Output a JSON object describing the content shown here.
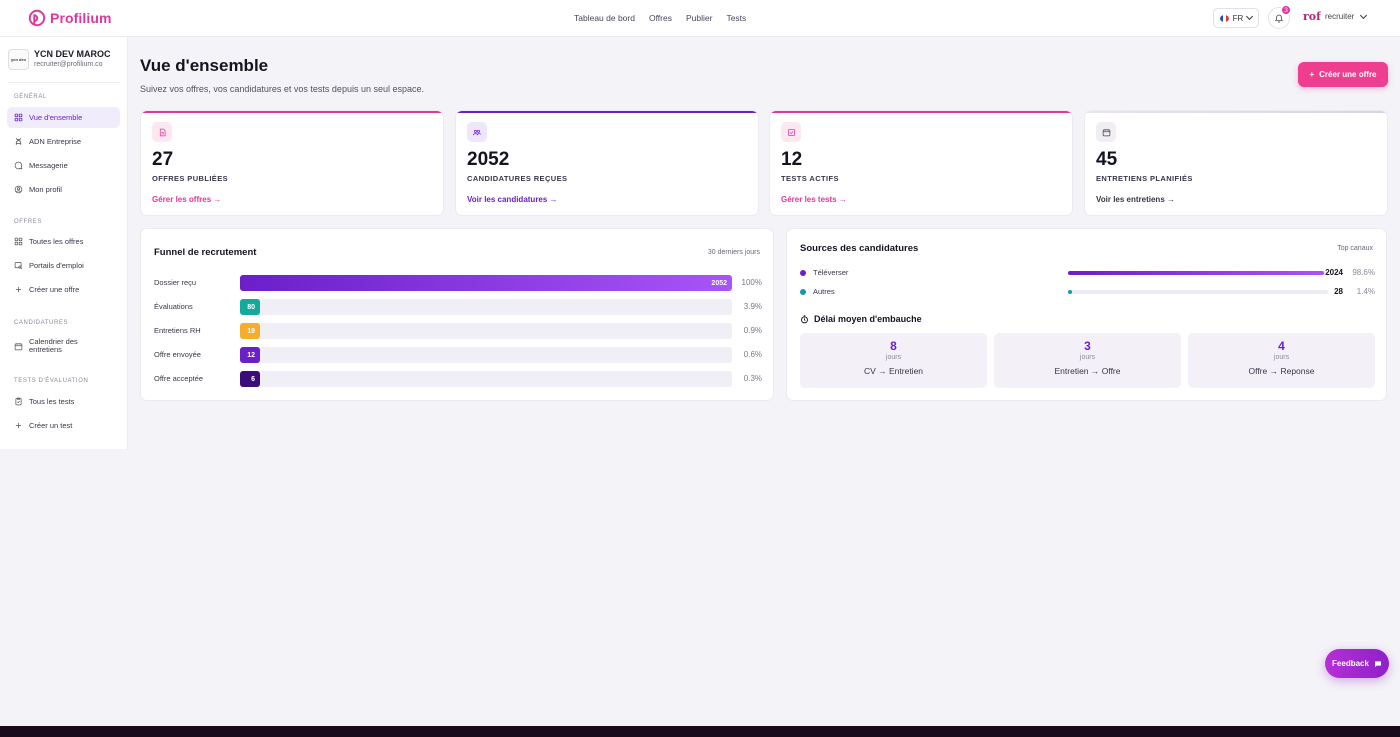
{
  "brand": {
    "name": "Profilium",
    "accent": "#e0379b",
    "purple": "#6b1fc8"
  },
  "topnav": [
    "Tableau de bord",
    "Offres",
    "Publier",
    "Tests"
  ],
  "header": {
    "lang": "FR",
    "notif_count": "3",
    "user_avatar_text": "rof",
    "user_label": "recruiter"
  },
  "company": {
    "logo_text": "ycn dev",
    "name": "YCN DEV MAROC",
    "email": "recruiter@profilium.co"
  },
  "sidebar": {
    "sections": [
      "GÉNÉRAL",
      "OFFRES",
      "CANDIDATURES",
      "TESTS D'ÉVALUATION"
    ],
    "general": [
      "Vue d'ensemble",
      "ADN Entreprise",
      "Messagerie",
      "Mon profil"
    ],
    "offres": [
      "Toutes les offres",
      "Portails d'emploi",
      "Créer une offre"
    ],
    "candidatures": [
      "Calendrier des entretiens"
    ],
    "tests": [
      "Tous les tests",
      "Créer un test"
    ]
  },
  "page": {
    "title": "Vue d'ensemble",
    "subtitle": "Suivez vos offres, vos candidatures et vos tests depuis un seul espace.",
    "create_button": "Créer une offre"
  },
  "stats": [
    {
      "value": "27",
      "label": "OFFRES PUBLIÉES",
      "link": "Gérer les offres →",
      "color": "#e0379b",
      "icon": "document-icon"
    },
    {
      "value": "2052",
      "label": "CANDIDATURES REÇUES",
      "link": "Voir les candidatures →",
      "color": "#6b1fc8",
      "icon": "users-icon"
    },
    {
      "value": "12",
      "label": "TESTS ACTIFS",
      "link": "Gérer les tests →",
      "color": "#e0379b",
      "icon": "checklist-icon"
    },
    {
      "value": "45",
      "label": "ENTRETIENS PLANIFIÉS",
      "link": "Voir les entretiens →",
      "color": "#3a3646",
      "icon": "calendar-icon"
    }
  ],
  "funnel": {
    "title": "Funnel de recrutement",
    "period": "30 derniers jours",
    "rows": [
      {
        "label": "Dossier reçu",
        "value": "2052",
        "pct": "100%",
        "fraction": 1.0,
        "color": "#6b1fc8"
      },
      {
        "label": "Évaluations",
        "value": "80",
        "pct": "3.9%",
        "fraction": 0.039,
        "color": "#14a99a"
      },
      {
        "label": "Entretiens RH",
        "value": "19",
        "pct": "0.9%",
        "fraction": 0.009,
        "color": "#f5ad2a"
      },
      {
        "label": "Offre envoyée",
        "value": "12",
        "pct": "0.6%",
        "fraction": 0.006,
        "color": "#6b1fc8"
      },
      {
        "label": "Offre acceptée",
        "value": "6",
        "pct": "0.3%",
        "fraction": 0.003,
        "color": "#3b0c7a"
      }
    ]
  },
  "sources": {
    "title": "Sources des candidatures",
    "top": "Top canaux",
    "rows": [
      {
        "label": "Téléverser",
        "count": "2024",
        "pct": "98.6%",
        "fraction": 0.986,
        "color": "#6b1fc8"
      },
      {
        "label": "Autres",
        "count": "28",
        "pct": "1.4%",
        "fraction": 0.014,
        "color": "#1597b8"
      }
    ]
  },
  "delay": {
    "title": "Délai moyen d'embauche",
    "items": [
      {
        "value": "8",
        "unit": "jours",
        "label": "CV → Entretien"
      },
      {
        "value": "3",
        "unit": "jours",
        "label": "Entretien → Offre"
      },
      {
        "value": "4",
        "unit": "jours",
        "label": "Offre → Reponse"
      }
    ]
  },
  "feedback": "Feedback"
}
